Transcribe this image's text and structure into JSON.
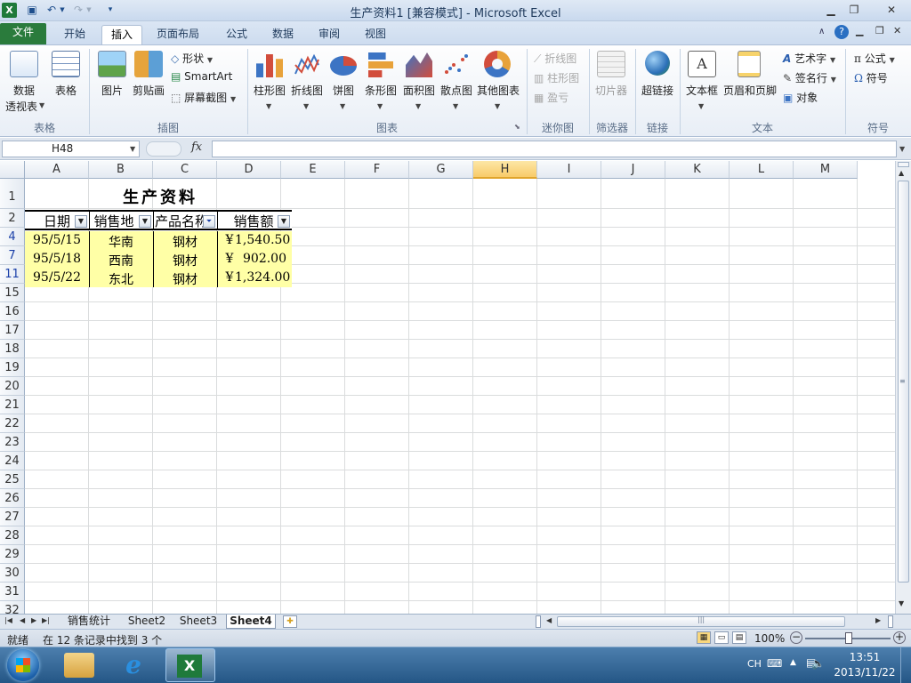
{
  "window": {
    "title": "生产资料1 [兼容模式] - Microsoft Excel"
  },
  "tabs": [
    "开始",
    "插入",
    "页面布局",
    "公式",
    "数据",
    "审阅",
    "视图"
  ],
  "file_tab": "文件",
  "ribbon": {
    "tables": {
      "label": "表格",
      "pivot_l1": "数据",
      "pivot_l2": "透视表",
      "table": "表格"
    },
    "illustrations": {
      "label": "插图",
      "picture": "图片",
      "clipart": "剪贴画",
      "shapes": "形状",
      "smartart": "SmartArt",
      "screenshot": "屏幕截图"
    },
    "charts": {
      "label": "图表",
      "column": "柱形图",
      "line": "折线图",
      "pie": "饼图",
      "bar": "条形图",
      "area": "面积图",
      "scatter": "散点图",
      "other": "其他图表"
    },
    "sparklines": {
      "label": "迷你图",
      "line": "折线图",
      "column": "柱形图",
      "winloss": "盈亏"
    },
    "filter": {
      "label": "筛选器",
      "slicer": "切片器"
    },
    "links": {
      "label": "链接",
      "hyperlink": "超链接"
    },
    "text": {
      "label": "文本",
      "textbox": "文本框",
      "header_footer": "页眉和页脚",
      "wordart": "艺术字",
      "signature": "签名行",
      "object": "对象"
    },
    "symbols": {
      "label": "符号",
      "equation": "公式",
      "symbol": "符号"
    }
  },
  "formula_bar": {
    "name_box": "H48",
    "fx": "fx",
    "value": ""
  },
  "columns": [
    "A",
    "B",
    "C",
    "D",
    "E",
    "F",
    "G",
    "H",
    "I",
    "J",
    "K",
    "L",
    "M"
  ],
  "selected_column": "H",
  "rows": [
    "1",
    "2",
    "4",
    "7",
    "11",
    "15",
    "16",
    "17",
    "18",
    "19",
    "20",
    "21",
    "22",
    "23",
    "24",
    "25",
    "26",
    "27",
    "28",
    "29",
    "30",
    "31",
    "32"
  ],
  "sheet": {
    "title": "生产资料",
    "headers": [
      "日期",
      "销售地",
      "产品名称",
      "销售额"
    ],
    "data_rows": [
      {
        "date": "95/5/15",
        "region": "华南",
        "product": "钢材",
        "currency": "¥",
        "amount": "1,540.50"
      },
      {
        "date": "95/5/18",
        "region": "西南",
        "product": "钢材",
        "currency": "¥",
        "amount": "902.00"
      },
      {
        "date": "95/5/22",
        "region": "东北",
        "product": "钢材",
        "currency": "¥",
        "amount": "1,324.00"
      }
    ]
  },
  "sheet_tabs": [
    "销售统计",
    "Sheet2",
    "Sheet3",
    "Sheet4"
  ],
  "active_sheet": "Sheet4",
  "status": {
    "ready": "就绪",
    "filter_msg": "在 12 条记录中找到 3 个",
    "zoom": "100%",
    "zoom_level_percent": 100
  },
  "taskbar": {
    "ime": "CH",
    "time": "13:51",
    "date": "2013/11/22"
  },
  "colors": {
    "file_tab": "#2a7b3c",
    "filtered_fill": "#ffffa6",
    "selected_header": "#f8cb6a",
    "filtered_row_number": "#1a3fa8"
  }
}
